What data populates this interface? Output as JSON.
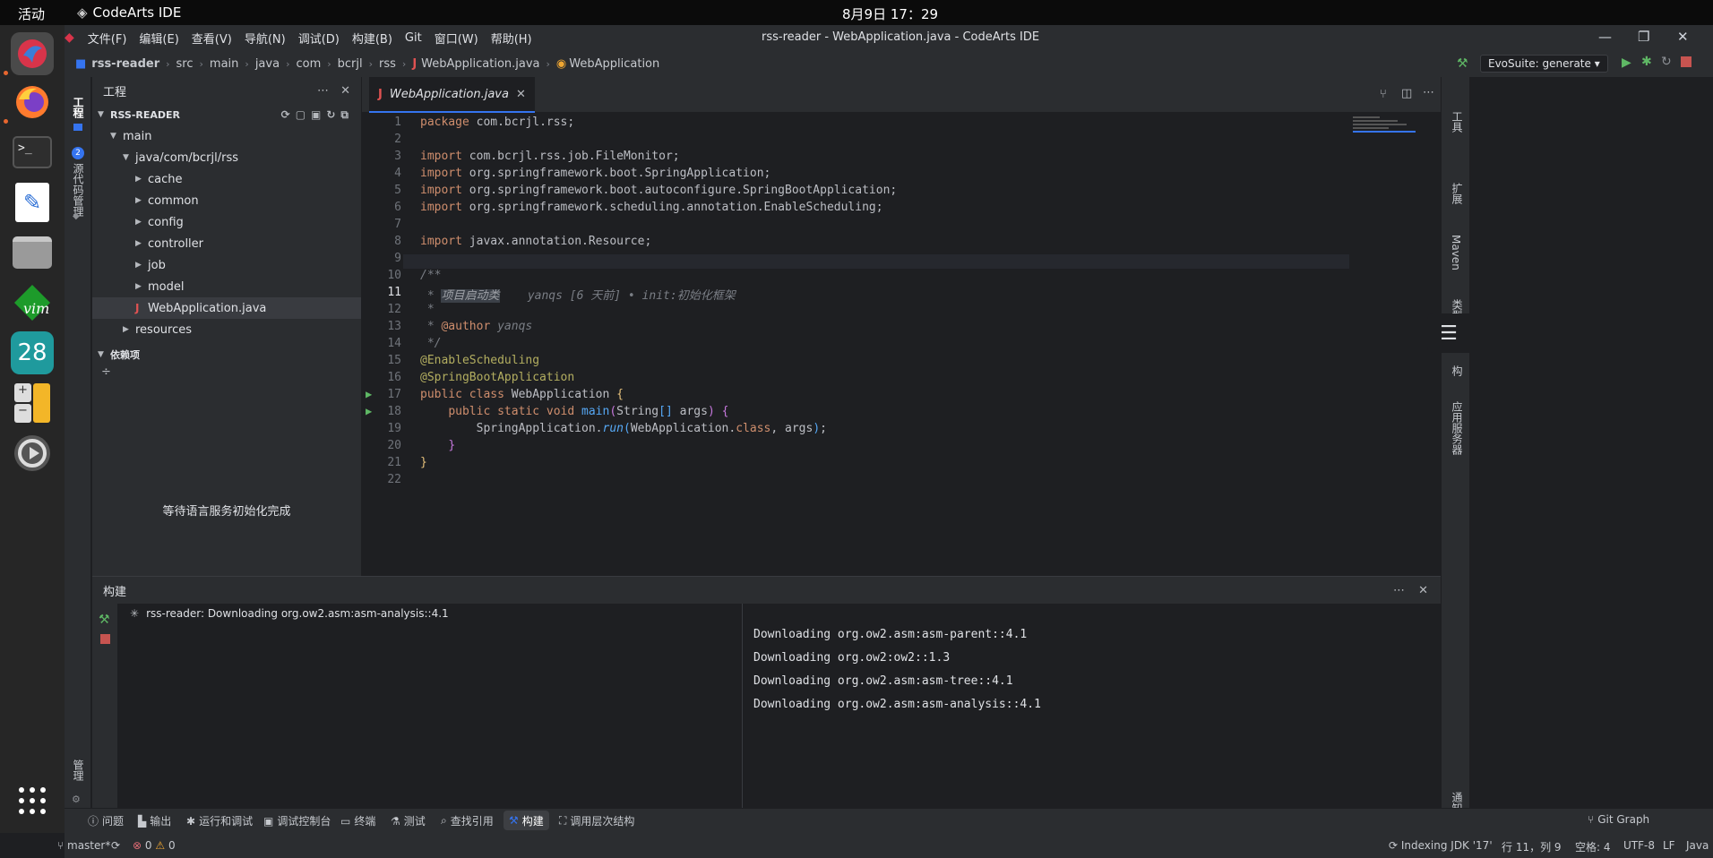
{
  "topbar": {
    "activities": "活动",
    "app_name": "CodeArts IDE",
    "clock": "8月9日 17：29"
  },
  "window": {
    "title": "rss-reader - WebApplication.java - CodeArts IDE"
  },
  "menu": [
    "文件(F)",
    "编辑(E)",
    "查看(V)",
    "导航(N)",
    "调试(D)",
    "构建(B)",
    "Git",
    "窗口(W)",
    "帮助(H)"
  ],
  "breadcrumb": [
    "rss-reader",
    "src",
    "main",
    "java",
    "com",
    "bcrjl",
    "rss",
    "WebApplication.java",
    "WebApplication"
  ],
  "toolbar": {
    "run_config": "EvoSuite: generate"
  },
  "left_stripe": {
    "project": "工程",
    "badge": "2",
    "scm": "源代码管理",
    "bottom": "管理"
  },
  "project": {
    "title": "工程",
    "root": "RSS-READER",
    "tree": [
      {
        "label": "main",
        "depth": 1,
        "arrow": "▼"
      },
      {
        "label": "java/com/bcrjl/rss",
        "depth": 2,
        "arrow": "▼"
      },
      {
        "label": "cache",
        "depth": 3,
        "arrow": "▶"
      },
      {
        "label": "common",
        "depth": 3,
        "arrow": "▶"
      },
      {
        "label": "config",
        "depth": 3,
        "arrow": "▶"
      },
      {
        "label": "controller",
        "depth": 3,
        "arrow": "▶"
      },
      {
        "label": "job",
        "depth": 3,
        "arrow": "▶"
      },
      {
        "label": "model",
        "depth": 3,
        "arrow": "▶"
      },
      {
        "label": "WebApplication.java",
        "depth": 3,
        "arrow": "J"
      },
      {
        "label": "resources",
        "depth": 2,
        "arrow": "▶"
      }
    ],
    "deps_title": "依赖项",
    "waiting": "等待语言服务初始化完成"
  },
  "editor": {
    "tab": "WebApplication.java",
    "blame": "yanqs [6 天前] • init:初始化框架"
  },
  "right_stripe": [
    "工具",
    "扩展",
    "Maven",
    "类型层次结",
    "构",
    "应用服务器",
    "通知"
  ],
  "build": {
    "title": "构建",
    "task": "rss-reader: Downloading org.ow2.asm:asm-analysis::4.1",
    "output": [
      "Downloading org.ow2.asm:asm-parent::4.1",
      "Downloading org.ow2:ow2::1.3",
      "Downloading org.ow2.asm:asm-tree::4.1",
      "Downloading org.ow2.asm:asm-analysis::4.1"
    ]
  },
  "tooltabs": [
    "问题",
    "输出",
    "运行和调试",
    "调试控制台",
    "终端",
    "测试",
    "查找引用",
    "构建",
    "调用层次结构"
  ],
  "git_graph": "Git Graph",
  "status": {
    "branch": "master*",
    "errors": "0",
    "warnings": "0",
    "indexing": "Indexing JDK '17'",
    "position": "行 11，列 9",
    "indent": "空格: 4",
    "encoding": "UTF-8",
    "eol": "LF",
    "lang": "Java"
  },
  "colors": {
    "accent": "#3574f0",
    "run": "#5fb865",
    "stop": "#e06c75",
    "bg": "#1e1f22",
    "panel": "#2b2d30"
  }
}
